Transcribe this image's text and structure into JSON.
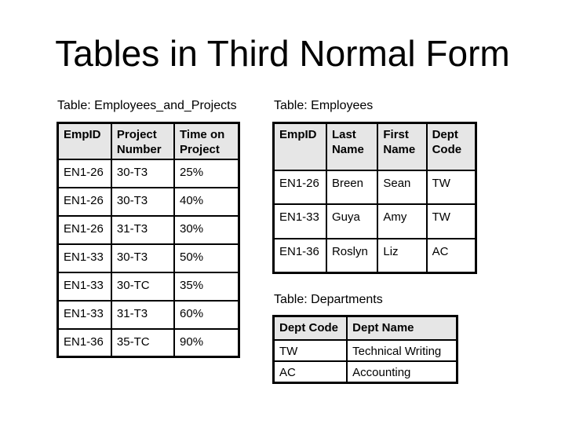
{
  "title": "Tables in Third Normal Form",
  "employees_and_projects": {
    "caption": "Table: Employees_and_Projects",
    "headers": [
      [
        "EmpID"
      ],
      [
        "Project",
        "Number"
      ],
      [
        "Time on",
        "Project"
      ]
    ],
    "rows": [
      [
        "EN1-26",
        "30-T3",
        "25%"
      ],
      [
        "EN1-26",
        "30-T3",
        "40%"
      ],
      [
        "EN1-26",
        "31-T3",
        "30%"
      ],
      [
        "EN1-33",
        "30-T3",
        "50%"
      ],
      [
        "EN1-33",
        "30-TC",
        "35%"
      ],
      [
        "EN1-33",
        "31-T3",
        "60%"
      ],
      [
        "EN1-36",
        "35-TC",
        "90%"
      ]
    ]
  },
  "employees": {
    "caption": "Table: Employees",
    "headers": [
      [
        "EmpID"
      ],
      [
        "Last",
        "Name"
      ],
      [
        "First",
        "Name"
      ],
      [
        "Dept",
        "Code"
      ]
    ],
    "rows": [
      [
        "EN1-26",
        "Breen",
        "Sean",
        "TW"
      ],
      [
        "EN1-33",
        "Guya",
        "Amy",
        "TW"
      ],
      [
        "EN1-36",
        "Roslyn",
        "Liz",
        "AC"
      ]
    ]
  },
  "departments": {
    "caption": "Table: Departments",
    "headers": [
      [
        "Dept Code"
      ],
      [
        "Dept Name"
      ]
    ],
    "rows": [
      [
        "TW",
        "Technical Writing"
      ],
      [
        "AC",
        "Accounting"
      ]
    ]
  }
}
